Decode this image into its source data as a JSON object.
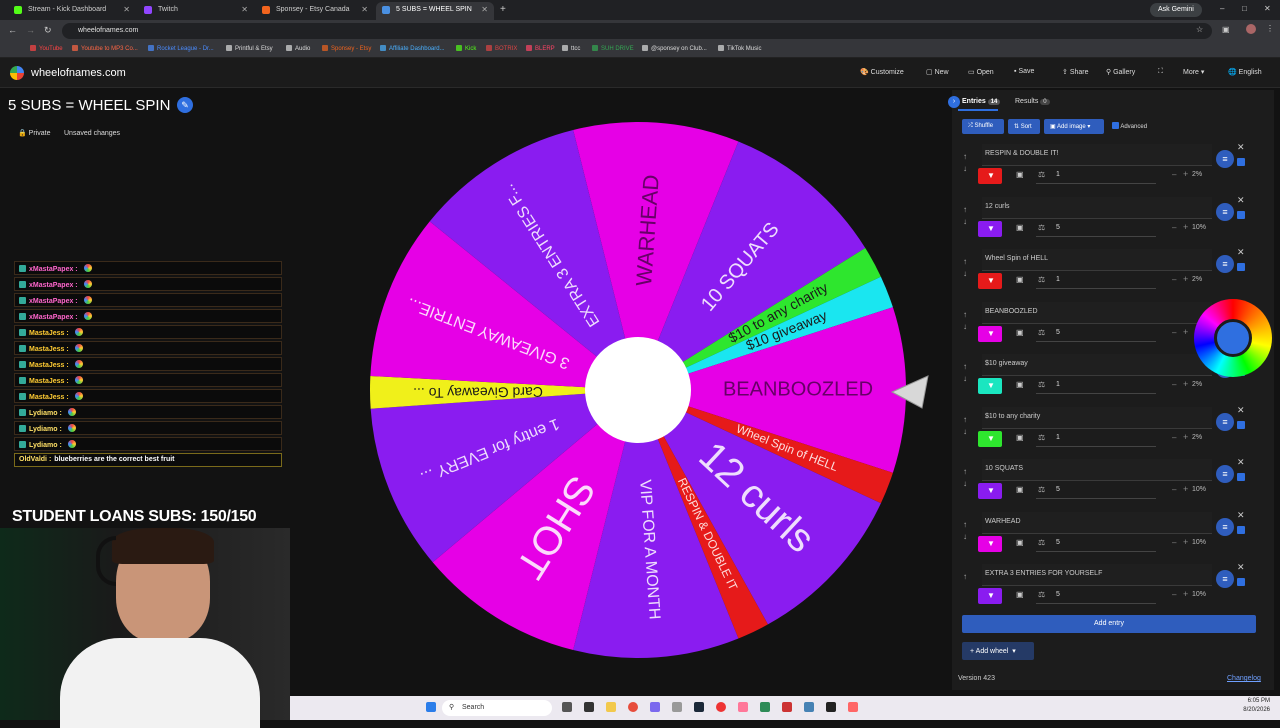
{
  "browser": {
    "tabs": [
      {
        "label": "Stream - Kick Dashboard",
        "color": "#53fc18"
      },
      {
        "label": "Twitch",
        "color": "#9146ff"
      },
      {
        "label": "Sponsey - Etsy Canada",
        "color": "#f1641e"
      },
      {
        "label": "5 SUBS = WHEEL SPIN",
        "color": "#4a90e2"
      }
    ],
    "ask": "Ask Gemini",
    "url": "wheelofnames.com",
    "bookmarks": [
      "YouTube",
      "Youtube to MP3 Co...",
      "Rocket League - Dr...",
      "Printful & Etsy",
      "Audio",
      "Sponsey - Etsy",
      "Affiliate Dashboard...",
      "Kick",
      "BOTRIX",
      "BLERP",
      "ttcc",
      "SUH DRIVE",
      "@sponsey on Club...",
      "TikTok Music"
    ]
  },
  "app": {
    "logo": "wheelofnames.com",
    "menu": [
      "Customize",
      "New",
      "Open",
      "Save",
      "Share",
      "Gallery",
      "More",
      "English"
    ],
    "title": "5 SUBS = WHEEL SPIN",
    "private": "Private",
    "unsaved": "Unsaved changes"
  },
  "chat": [
    {
      "user": "xMastaPapex :",
      "msg": "",
      "color": "#ff66cc"
    },
    {
      "user": "xMastaPapex :",
      "msg": "",
      "color": "#ff66cc"
    },
    {
      "user": "xMastaPapex :",
      "msg": "",
      "color": "#ff66cc"
    },
    {
      "user": "xMastaPapex :",
      "msg": "",
      "color": "#ff66cc"
    },
    {
      "user": "MastaJess :",
      "msg": "",
      "color": "#ffcc33"
    },
    {
      "user": "MastaJess :",
      "msg": "",
      "color": "#ffcc33"
    },
    {
      "user": "MastaJess :",
      "msg": "",
      "color": "#ffcc33"
    },
    {
      "user": "MastaJess :",
      "msg": "",
      "color": "#ffcc33"
    },
    {
      "user": "MastaJess :",
      "msg": "",
      "color": "#ffcc33"
    },
    {
      "user": "Lydiamo :",
      "msg": "",
      "color": "#ffe066"
    },
    {
      "user": "Lydiamo :",
      "msg": "",
      "color": "#ffe066"
    },
    {
      "user": "Lydiamo :",
      "msg": "",
      "color": "#ffe066"
    },
    {
      "user": "OldValdi :",
      "msg": "blueberries are the correct best fruit",
      "color": "#ffe066"
    }
  ],
  "student_loans": "STUDENT LOANS SUBS: 150/150",
  "wheel": {
    "colors": {
      "magenta": "#e600e6",
      "purple": "#8a1cf0",
      "green": "#2ee62e",
      "cyan": "#1ae6f0",
      "yellow": "#f0f01a",
      "red": "#e61a1a"
    },
    "labels": [
      "WARHEAD",
      "10 SQUATS",
      "$10 to any charity",
      "$10 giveaway",
      "BEANBOOZLED",
      "Wheel Spin of HELL",
      "12 curls",
      "RESPIN & DOUBLE IT",
      "VIP FOR A MONTH",
      "SHOT",
      "1 entry for EVERY ...",
      "Card Giveaway To ...",
      "3 GIVEAWAY ENTRIE...",
      "EXTRA 3 ENTRIES F..."
    ]
  },
  "panel": {
    "tab_entries": "Entries",
    "entries_count": "14",
    "tab_results": "Results",
    "results_count": "0",
    "shuffle": "Shuffle",
    "sort": "Sort",
    "add_image": "Add image",
    "advanced": "Advanced",
    "entries": [
      {
        "text": "RESPIN & DOUBLE IT!",
        "weight": "1",
        "pct": "2%",
        "color": "#e61a1a"
      },
      {
        "text": "12 curls",
        "weight": "5",
        "pct": "10%",
        "color": "#8a1cf0"
      },
      {
        "text": "Wheel Spin of HELL",
        "weight": "1",
        "pct": "2%",
        "color": "#e61a1a"
      },
      {
        "text": "BEANBOOZLED",
        "weight": "5",
        "pct": "",
        "color": "#e600e6"
      },
      {
        "text": "$10 giveaway",
        "weight": "1",
        "pct": "2%",
        "color": "#1ae6c0"
      },
      {
        "text": "$10 to any charity",
        "weight": "1",
        "pct": "2%",
        "color": "#2ee62e"
      },
      {
        "text": "10 SQUATS",
        "weight": "5",
        "pct": "10%",
        "color": "#8a1cf0"
      },
      {
        "text": "WARHEAD",
        "weight": "5",
        "pct": "10%",
        "color": "#e600e6"
      },
      {
        "text": "EXTRA 3 ENTRIES FOR YOURSELF",
        "weight": "5",
        "pct": "10%",
        "color": "#8a1cf0"
      }
    ],
    "add_entry": "Add entry",
    "add_wheel": "Add wheel",
    "version": "Version 423",
    "changelog": "Changelog"
  },
  "taskbar": {
    "search": "Search",
    "time": "6:05 PM",
    "date": "8/20/2026"
  }
}
